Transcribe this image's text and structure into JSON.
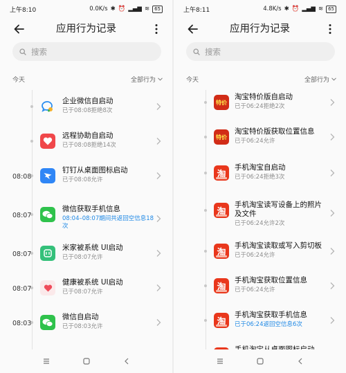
{
  "left": {
    "status": {
      "time": "上午8:10",
      "speed": "0.0K/s",
      "battery": "65"
    },
    "header": {
      "title": "应用行为记录"
    },
    "search": {
      "placeholder": "搜索"
    },
    "subhead": {
      "today": "今天",
      "filter": "全部行为"
    },
    "entries": [
      {
        "time": "",
        "app": "企业微信",
        "name": "企业微信自启动",
        "detail": "已于08:08拒绝8次",
        "detail_highlight": false
      },
      {
        "time": "",
        "app": "远程协助",
        "name": "远程协助自启动",
        "detail": "已于08:08拒绝14次",
        "detail_highlight": false
      },
      {
        "time": "08:08",
        "app": "钉钉",
        "name": "钉钉从桌面图标启动",
        "detail": "已于08:08允许",
        "detail_highlight": false
      },
      {
        "time": "08:07",
        "app": "微信",
        "name": "微信获取手机信息",
        "detail": "08:04–08:07期间共返回空信息18次",
        "detail_highlight": true
      },
      {
        "time": "08:07",
        "app": "米家",
        "name": "米家被系统 UI启动",
        "detail": "已于08:07允许",
        "detail_highlight": false
      },
      {
        "time": "08:07",
        "app": "健康",
        "name": "健康被系统 UI启动",
        "detail": "已于08:07允许",
        "detail_highlight": false
      },
      {
        "time": "08:03",
        "app": "微信",
        "name": "微信自启动",
        "detail": "已于08:03允许",
        "detail_highlight": false
      }
    ]
  },
  "right": {
    "status": {
      "time": "上午8:11",
      "speed": "4.8K/s",
      "battery": "65"
    },
    "header": {
      "title": "应用行为记录"
    },
    "search": {
      "placeholder": "搜索"
    },
    "subhead": {
      "today": "今天",
      "filter": "全部行为"
    },
    "entries": [
      {
        "app": "淘宝特价版",
        "icon_text": "特价",
        "name": "淘宝特价版自启动",
        "detail": "已于06:24拒绝2次",
        "detail_highlight": false
      },
      {
        "app": "淘宝特价版",
        "icon_text": "特价",
        "name": "淘宝特价版获取位置信息",
        "detail": "已于06:24允许",
        "detail_highlight": false
      },
      {
        "app": "手机淘宝",
        "icon_text": "淘",
        "name": "手机淘宝自启动",
        "detail": "已于06:24拒绝3次",
        "detail_highlight": false
      },
      {
        "app": "手机淘宝",
        "icon_text": "淘",
        "name": "手机淘宝读写设备上的照片及文件",
        "detail": "已于06:24允许2次",
        "detail_highlight": false
      },
      {
        "app": "手机淘宝",
        "icon_text": "淘",
        "name": "手机淘宝读取或写入剪切板",
        "detail": "已于06:24允许",
        "detail_highlight": false
      },
      {
        "app": "手机淘宝",
        "icon_text": "淘",
        "name": "手机淘宝获取位置信息",
        "detail": "已于06:24允许",
        "detail_highlight": false
      },
      {
        "app": "手机淘宝",
        "icon_text": "淘",
        "name": "手机淘宝获取手机信息",
        "detail": "已于06:24返回空信息6次",
        "detail_highlight": true
      },
      {
        "app": "手机淘宝",
        "icon_text": "淘",
        "name": "手机淘宝从桌面图标启动",
        "detail": "",
        "detail_highlight": false
      }
    ]
  },
  "colors": {
    "accent_blue": "#1e88e5",
    "taobao_red": "#e9371c",
    "wechat_green": "#2fc24c"
  }
}
